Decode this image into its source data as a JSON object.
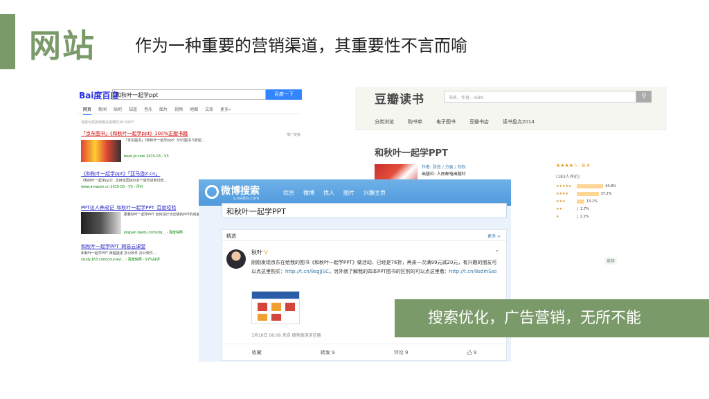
{
  "slide": {
    "title": "网站",
    "subtitle": "作为一种重要的营销渠道，其重要性不言而喻",
    "callout": "搜索优化，广告营销，无所不能",
    "accent_color": "#7b9a6a"
  },
  "baidu": {
    "logo": "Bai度百度",
    "query": "和秋叶一起学ppt",
    "search_button": "百度一下",
    "tabs": [
      "网页",
      "新闻",
      "贴吧",
      "知道",
      "音乐",
      "图片",
      "视频",
      "地图",
      "文库",
      "更多»"
    ],
    "stats": "百度为您找到相关结果约38,500个",
    "feedback": "推广链接",
    "results": [
      {
        "title": "「京东图书」《和秋叶一起学ppt》100%正版书籍",
        "url": "book.jd.com 2015-03 - V3",
        "desc": "「京东图书」《和秋叶一起学ppt》30万图书 5折起...",
        "red": true
      },
      {
        "title": "《和秋叶一起学ppt》「亚马逊Z.cn」",
        "url": "www.amazon.cn 2015-03 - V3 - 评价",
        "desc": "《和秋叶一起学ppt》,支持全国900多个城市货到付款...",
        "red": false
      },
      {
        "title": "PPT达人养成记_和秋叶一起学PPT_百度经验",
        "url": "jingyan.baidu.com/z/q... - 百度快照",
        "desc": "跟着秋叶一起学PPT 如何设计出动感的PPT的封面 ...",
        "red": false
      },
      {
        "title": "和秋叶一起学PPT_网易云课堂",
        "url": "study.163.com/course/i... - 百度快照 - 97%好评",
        "desc": "和秋叶一起学PPT 课程描述 办公软件 办公软件...",
        "red": false
      }
    ]
  },
  "douban": {
    "logo": "豆瓣读书",
    "search_placeholder": "书名、作者、ISBN",
    "nav": [
      "分类浏览",
      "购书单",
      "电子图书",
      "豆瓣书店",
      "读书盘点2014"
    ],
    "book_title": "和秋叶一起学PPT",
    "meta_author": "作者: 张志 / 方骏 / 刘权",
    "meta_publisher": "出版社: 人民邮电出版社",
    "score": "8.4",
    "stars": "★★★★☆",
    "rating_count": "(183人评价)",
    "rating_bars": [
      {
        "stars": "★★★★★",
        "percent": "44.8%",
        "value": 44.8
      },
      {
        "stars": "★★★★",
        "percent": "37.2%",
        "value": 37.2
      },
      {
        "stars": "★★★",
        "percent": "13.1%",
        "value": 13.1
      },
      {
        "stars": "★★",
        "percent": "2.7%",
        "value": 2.7
      },
      {
        "stars": "★",
        "percent": "2.2%",
        "value": 2.2
      }
    ],
    "tag": "推荐"
  },
  "weibo": {
    "logo": "微博搜索",
    "logo_sub": "s.weibo.com",
    "nav": [
      "综合",
      "微博",
      "找人",
      "图片",
      "兴趣主页"
    ],
    "query": "和秋叶一起学PPT",
    "card_head": "精选",
    "more": "更多 >",
    "user_name": "秋叶",
    "verified": "V",
    "post_text": "刚刚发现京东在给我的图书《和秋叶一起学PPT》做活动，已经是76折，再来一次满99元减20元，有兴趣的朋友可以点这里购买：",
    "post_link1": "http://t.cn/8sgJJSC",
    "post_text2": "，另外就了解我的四本PPT图书的区别的可以点这里看：",
    "post_link2": "http://t.cn/8sdmSso",
    "time": "3月18日 08:08 来自 搜狗高速浏览器",
    "actions": [
      "收藏",
      "转发 9",
      "评论 9",
      "凸 9"
    ]
  }
}
